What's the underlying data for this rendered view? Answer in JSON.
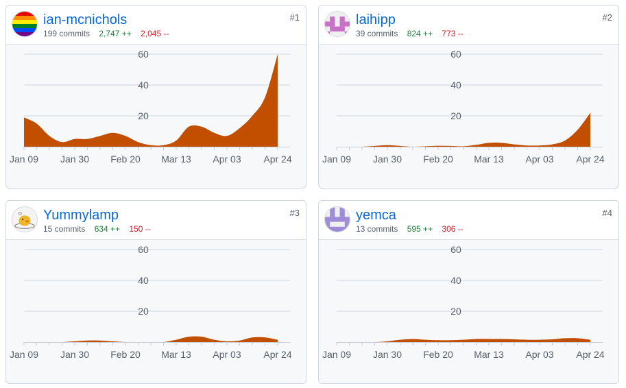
{
  "x_ticks": [
    "Jan 09",
    "Jan 30",
    "Feb 20",
    "Mar 13",
    "Apr 03",
    "Apr 24"
  ],
  "y_ticks": [
    "60",
    "40",
    "20"
  ],
  "colors": {
    "area": "#c24e00",
    "grid": "#d0d7de",
    "link": "#0969da",
    "add": "#1a7f37",
    "del": "#cf222e"
  },
  "contributors": [
    {
      "rank": "#1",
      "username": "ian-mcnichols",
      "commits": "199 commits",
      "additions": "2,747 ++",
      "deletions": "2,045 --",
      "avatar_icon": "rainbow-avatar-icon",
      "avatar_colors": [
        "#e40303",
        "#ff8c00",
        "#ffed00",
        "#008026",
        "#004dff",
        "#750787"
      ]
    },
    {
      "rank": "#2",
      "username": "laihipp",
      "commits": "39 commits",
      "additions": "824 ++",
      "deletions": "773 --",
      "avatar_icon": "identicon-pink-icon",
      "avatar_colors": [
        "#c870c8"
      ]
    },
    {
      "rank": "#3",
      "username": "Yummylamp",
      "commits": "15 commits",
      "additions": "634 ++",
      "deletions": "150 --",
      "avatar_icon": "yellow-duck-avatar-icon",
      "avatar_colors": [
        "#f0b429"
      ]
    },
    {
      "rank": "#4",
      "username": "yemca",
      "commits": "13 commits",
      "additions": "595 ++",
      "deletions": "306 --",
      "avatar_icon": "identicon-purple-icon",
      "avatar_colors": [
        "#9f8cd6"
      ]
    }
  ],
  "chart_data": [
    {
      "type": "area",
      "series": [
        {
          "values": [
            19,
            15,
            7,
            3,
            5,
            5,
            7,
            9,
            7,
            3,
            1,
            1,
            4,
            13,
            13,
            9,
            7,
            12,
            20,
            32,
            60
          ]
        }
      ],
      "x_ticks": [
        "Jan 09",
        "Jan 30",
        "Feb 20",
        "Mar 13",
        "Apr 03",
        "Apr 24"
      ],
      "ylim": [
        0,
        60
      ],
      "y_ticks": [
        60,
        40,
        20
      ]
    },
    {
      "type": "area",
      "series": [
        {
          "values": [
            0,
            0,
            0,
            0.5,
            1,
            0.5,
            0,
            0.3,
            0.6,
            0.5,
            0.3,
            1.2,
            2.5,
            2.5,
            1.5,
            0.8,
            0.8,
            1.5,
            4,
            11,
            22
          ]
        }
      ],
      "x_ticks": [
        "Jan 09",
        "Jan 30",
        "Feb 20",
        "Mar 13",
        "Apr 03",
        "Apr 24"
      ],
      "ylim": [
        0,
        60
      ],
      "y_ticks": [
        60,
        40,
        20
      ]
    },
    {
      "type": "area",
      "series": [
        {
          "values": [
            0,
            0,
            0,
            0,
            0.5,
            1,
            1,
            0.5,
            0,
            0,
            0,
            0,
            1.5,
            3.5,
            3.5,
            1.5,
            0.5,
            1,
            3,
            3,
            1.5
          ]
        }
      ],
      "x_ticks": [
        "Jan 09",
        "Jan 30",
        "Feb 20",
        "Mar 13",
        "Apr 03",
        "Apr 24"
      ],
      "ylim": [
        0,
        60
      ],
      "y_ticks": [
        60,
        40,
        20
      ]
    },
    {
      "type": "area",
      "series": [
        {
          "values": [
            0,
            0,
            0,
            0,
            0.5,
            1.5,
            2,
            1.5,
            1.2,
            1.2,
            1.5,
            2,
            2,
            2,
            1.8,
            1.5,
            1.5,
            1.8,
            2.5,
            2.5,
            1.5
          ]
        }
      ],
      "x_ticks": [
        "Jan 09",
        "Jan 30",
        "Feb 20",
        "Mar 13",
        "Apr 03",
        "Apr 24"
      ],
      "ylim": [
        0,
        60
      ],
      "y_ticks": [
        60,
        40,
        20
      ]
    }
  ]
}
